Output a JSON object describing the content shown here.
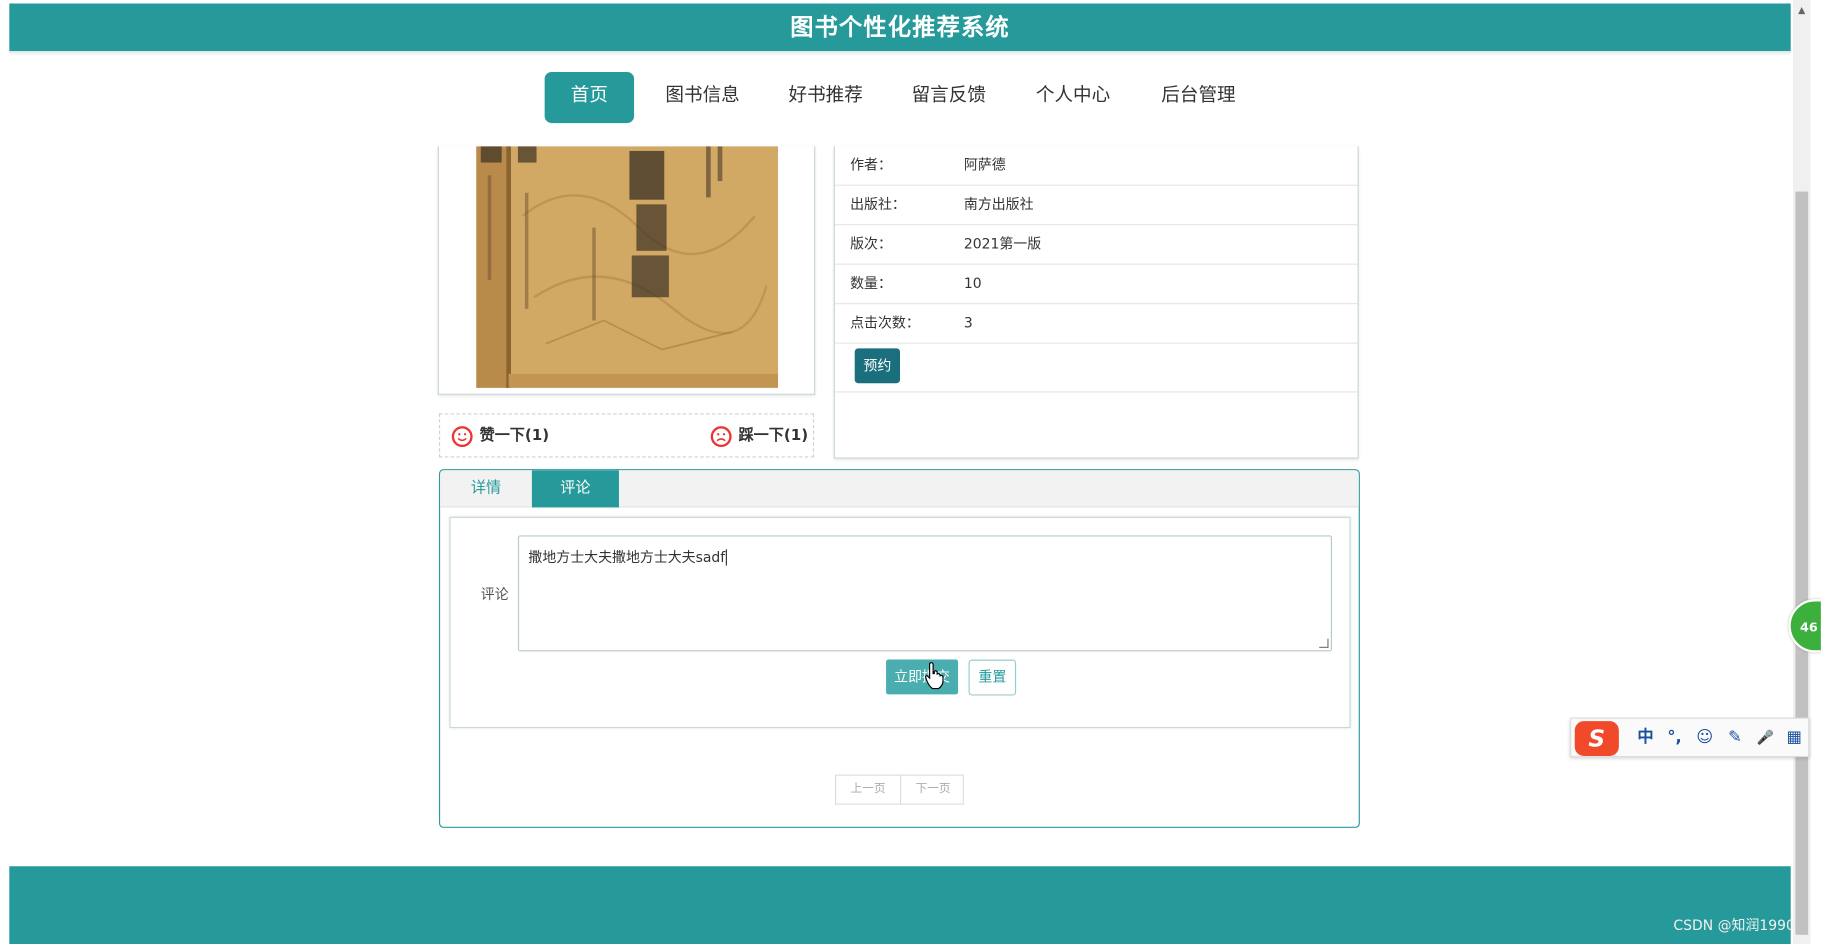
{
  "header": {
    "title": "图书个性化推荐系统"
  },
  "nav": {
    "items": [
      {
        "label": "首页",
        "active": true
      },
      {
        "label": "图书信息",
        "active": false
      },
      {
        "label": "好书推荐",
        "active": false
      },
      {
        "label": "留言反馈",
        "active": false
      },
      {
        "label": "个人中心",
        "active": false
      },
      {
        "label": "后台管理",
        "active": false
      }
    ]
  },
  "book": {
    "cover_icon": "book-cover-image",
    "info": [
      {
        "label": "作者：",
        "value": "阿萨德"
      },
      {
        "label": "出版社：",
        "value": "南方出版社"
      },
      {
        "label": "版次：",
        "value": "2021第一版"
      },
      {
        "label": "数量：",
        "value": "10"
      },
      {
        "label": "点击次数：",
        "value": "3"
      }
    ],
    "reserve_label": "预约"
  },
  "votes": {
    "like_label": "赞一下(1)",
    "dislike_label": "踩一下(1)"
  },
  "tabs": {
    "items": [
      {
        "label": "详情",
        "active": false
      },
      {
        "label": "评论",
        "active": true
      }
    ]
  },
  "comment_form": {
    "label": "评论",
    "value": "撒地方士大夫撒地方士大夫sadf",
    "submit_label": "立即提交",
    "reset_label": "重置"
  },
  "pager": {
    "prev_label": "上一页",
    "next_label": "下一页"
  },
  "widgets": {
    "float_badge": "46",
    "ime_logo": "S",
    "ime_items": [
      "中",
      "°,",
      "☺",
      "✎",
      "🎤",
      "▦"
    ]
  },
  "watermark": "CSDN @知润1990",
  "colors": {
    "accent": "#269a9b",
    "accent_dark": "#1b6f7c",
    "danger": "#e33333"
  }
}
